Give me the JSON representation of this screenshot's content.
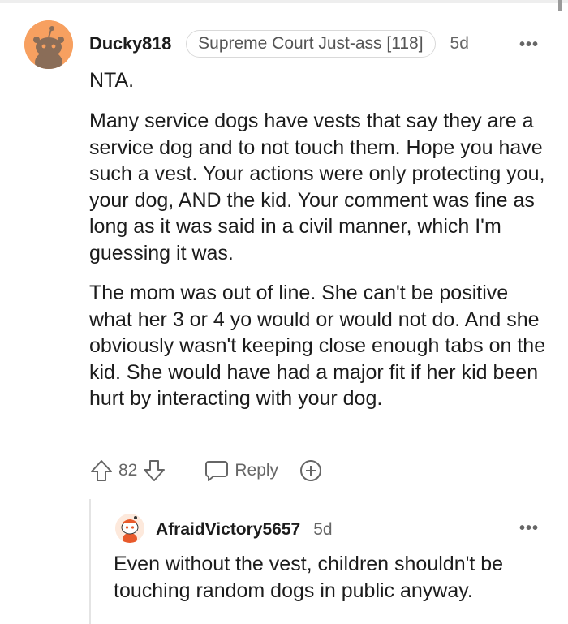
{
  "comment": {
    "username": "Ducky818",
    "flair": "Supreme Court Just-ass [118]",
    "age": "5d",
    "more": "•••",
    "paragraphs": [
      "NTA.",
      "Many service dogs have vests that say they are a service dog and to not touch them. Hope you have such a vest. Your actions were only protecting you, your dog, AND the kid. Your comment was fine as long as it was said in a civil manner, which I'm guessing it was.",
      "The mom was out of line. She can't be positive what her 3 or 4 yo would or would not do. And she obviously wasn't keeping close enough tabs on the kid. She would have had a major fit if her kid been hurt by interacting with your dog."
    ],
    "vote_count": "82",
    "reply_label": "Reply"
  },
  "reply": {
    "username": "AfraidVictory5657",
    "age": "5d",
    "more": "•••",
    "text": "Even without the vest, children shouldn't be touching random dogs in public anyway."
  },
  "colors": {
    "avatar_bg": "#f7a060",
    "meta_gray": "#666666",
    "text": "#1c1c1c"
  },
  "icons": {
    "upvote": "arrow-up-icon",
    "downvote": "arrow-down-icon",
    "reply": "speech-bubble-icon",
    "award": "award-plus-icon"
  }
}
